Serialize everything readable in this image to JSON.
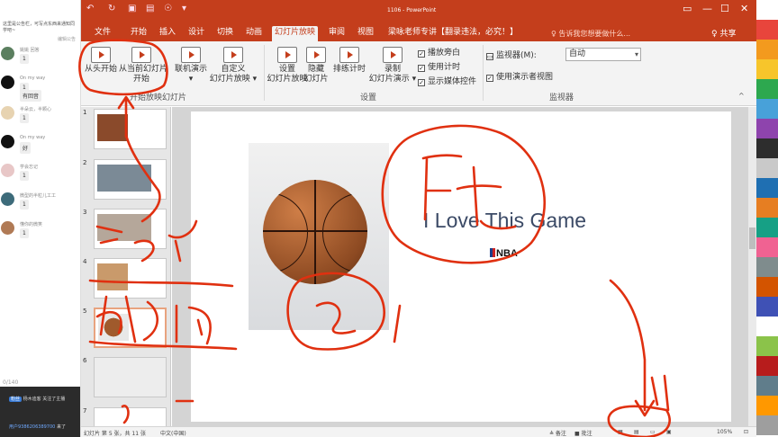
{
  "chat": {
    "notice": "这里是公告栏，可写点东西来通知同学吧~",
    "notice_tag": "编辑公告",
    "messages": [
      {
        "name": "姚姚 回答 ",
        "text": "1"
      },
      {
        "name": "On my way ",
        "text": "1"
      },
      {
        "name": "On my way ",
        "text": "有回音"
      },
      {
        "name": "半朵云，半颗心 ",
        "text": "1"
      },
      {
        "name": "On my way ",
        "text": "好"
      },
      {
        "name": "学会忘记 ",
        "text": "1"
      },
      {
        "name": "微型的半粒儿工工 ",
        "text": "1"
      },
      {
        "name": "懂你的微笑 ",
        "text": "1"
      }
    ],
    "counter": "0/140",
    "footer_badge": "粉丝",
    "footer_line1": "杨木迪客 关注了主播",
    "footer_user": "用户9386206389700",
    "footer_line2": " 来了"
  },
  "window": {
    "title": "1106 - PowerPoint",
    "controls": [
      "▭",
      "—",
      "☐",
      "✕"
    ]
  },
  "tabs": [
    "文件",
    "开始",
    "插入",
    "设计",
    "切换",
    "动画",
    "幻灯片放映",
    "审阅",
    "视图",
    "梁咏老师专讲【翻录违法，必究！】"
  ],
  "tell_me": "♀ 告诉我您想要做什么...",
  "share": "♀ 共享",
  "ribbon": {
    "from_beginning": "从头开始",
    "from_current_1": "从当前幻灯片",
    "from_current_2": "开始",
    "online_1": "联机演示",
    "online_2": "▾",
    "custom_1": "自定义",
    "custom_2": "幻灯片放映 ▾",
    "group_start": "开始放映幻灯片",
    "setup_1": "设置",
    "setup_2": "幻灯片放映",
    "hide_1": "隐藏",
    "hide_2": "幻灯片",
    "rehearse": "排练计时",
    "record_1": "录制",
    "record_2": "幻灯片演示 ▾",
    "cb_narration": "播放旁白",
    "cb_timing": "使用计时",
    "cb_media": "显示媒体控件",
    "group_setup": "设置",
    "monitor_label": "监视器(M):",
    "monitor_value": "自动",
    "presenter_view": "使用演示者视图",
    "group_monitor": "监视器"
  },
  "thumb_numbers": [
    "1",
    "2",
    "3",
    "4",
    "5",
    "6",
    "7"
  ],
  "slide": {
    "title": "I Love This Game",
    "logo": "NBA"
  },
  "status": {
    "slide_info": "幻灯片 第 5 张，共 11 张",
    "language": "中文(中国)",
    "notes": "≜ 备注",
    "comments": "■ 批注",
    "zoom": "105%"
  },
  "swatch_colors": [
    "#ffffff",
    "#e8453c",
    "#f39a1e",
    "#f7c52b",
    "#2da84f",
    "#48a1d9",
    "#8e44ad",
    "#2d2d2d",
    "#c9c9c9",
    "#1f6fb2",
    "#e67e22",
    "#16a085",
    "#f06292",
    "#7f8c8d",
    "#d35400",
    "#3f51b5",
    "#ffffff",
    "#8bc34a",
    "#b71c1c",
    "#607d8b",
    "#ff9800",
    "#9e9e9e"
  ],
  "ink_color": "#e03010"
}
